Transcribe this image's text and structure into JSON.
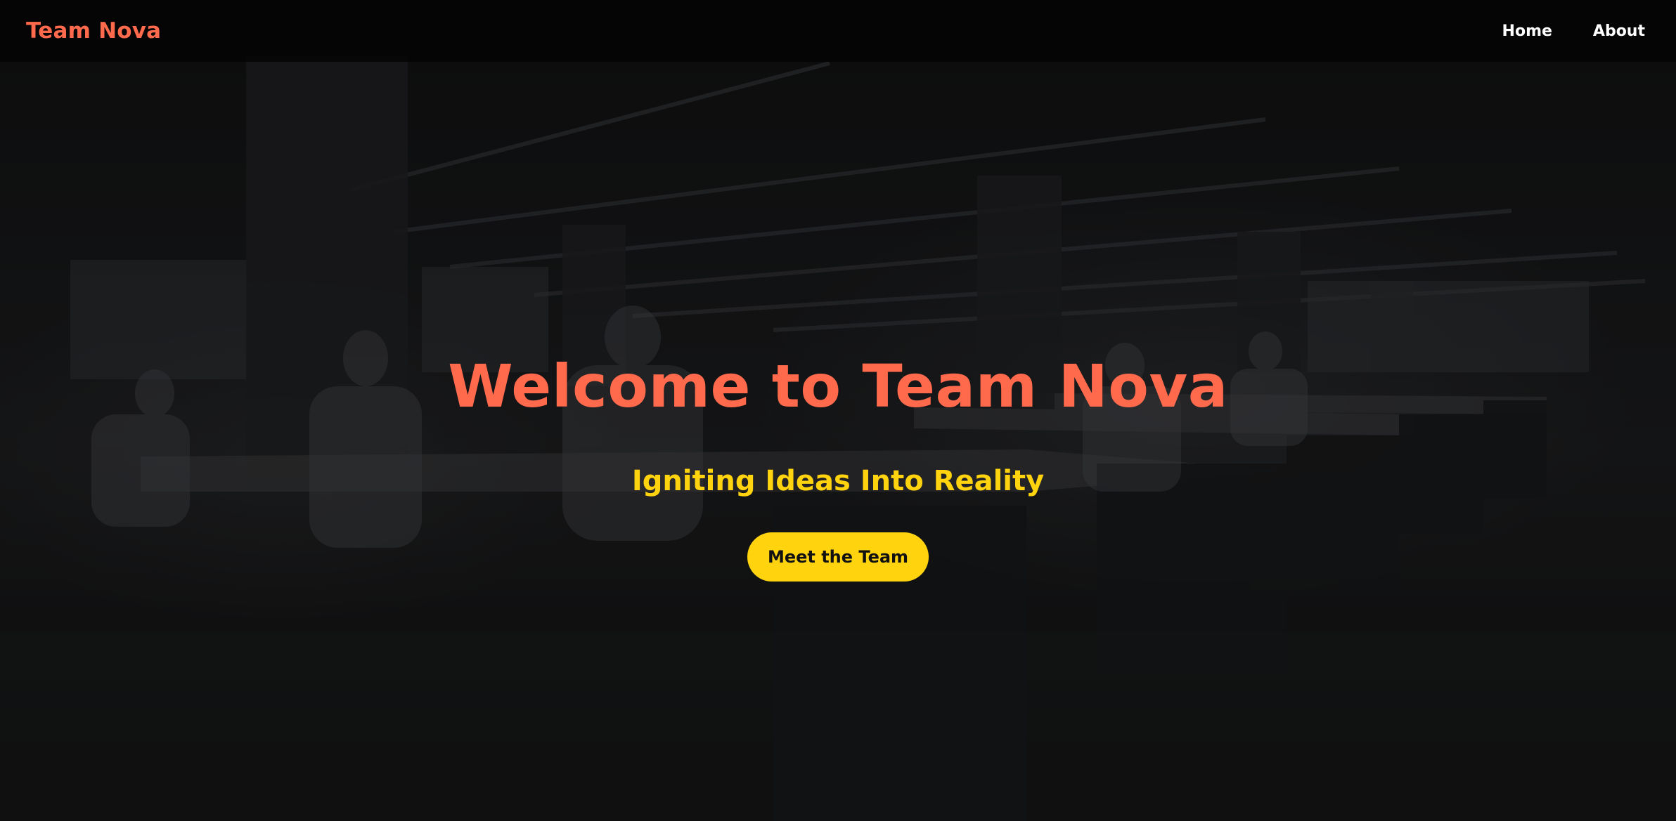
{
  "navbar": {
    "brand": "Team Nova",
    "links": [
      {
        "label": "Home"
      },
      {
        "label": "About"
      }
    ]
  },
  "hero": {
    "title": "Welcome to Team Nova",
    "subtitle": "Igniting Ideas Into Reality",
    "cta_label": "Meet the Team",
    "background": "dark-office-photo"
  },
  "colors": {
    "brand": "#ff6a4d",
    "accent": "#ffd40f",
    "nav_text": "#ffffff",
    "nav_bg": "#050505"
  }
}
